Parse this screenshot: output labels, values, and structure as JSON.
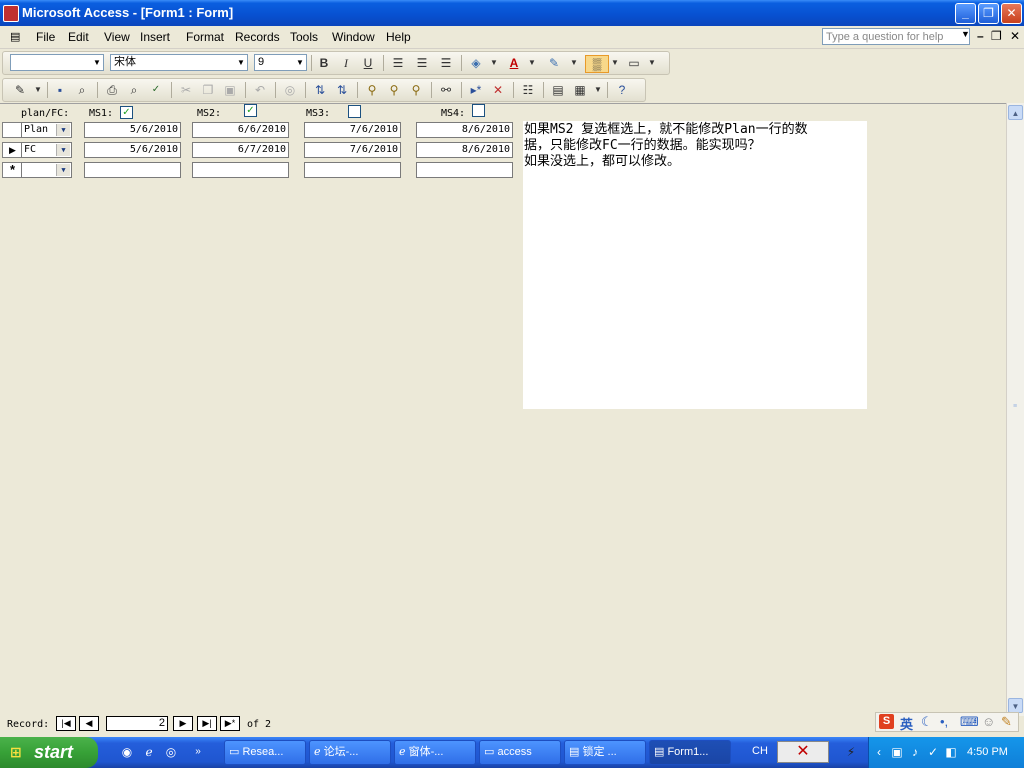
{
  "window": {
    "title": "Microsoft Access - [Form1 : Form]"
  },
  "menu": {
    "items": [
      "File",
      "Edit",
      "View",
      "Insert",
      "Format",
      "Records",
      "Tools",
      "Window",
      "Help"
    ],
    "help_placeholder": "Type a question for help"
  },
  "formatting_toolbar": {
    "object_value": "",
    "font_value": "宋体",
    "size_value": "9"
  },
  "form": {
    "header_labels": {
      "plan_fc": "plan/FC:",
      "ms1": "MS1:",
      "ms2": "MS2:",
      "ms3": "MS3:",
      "ms4": "MS4:"
    },
    "header_checks": {
      "ms1": true,
      "ms2": true,
      "ms3": false,
      "ms4": false
    },
    "rows": [
      {
        "selector": "",
        "type": "Plan",
        "ms1": "5/6/2010",
        "ms2": "6/6/2010",
        "ms3": "7/6/2010",
        "ms4": "8/6/2010"
      },
      {
        "selector": "▶",
        "type": "FC",
        "ms1": "5/6/2010",
        "ms2": "6/7/2010",
        "ms3": "7/6/2010",
        "ms4": "8/6/2010"
      },
      {
        "selector": "*",
        "type": "",
        "ms1": "",
        "ms2": "",
        "ms3": "",
        "ms4": ""
      }
    ],
    "note_lines": [
      "如果MS2 复选框选上，就不能修改Plan一行的数",
      "据，只能修改FC一行的数据。能实现吗？",
      "如果没选上，都可以修改。"
    ]
  },
  "record_nav": {
    "label": "Record:",
    "current": "2",
    "of_text": "of 2"
  },
  "taskbar": {
    "start_label": "start",
    "tasks": [
      "Resea...",
      "论坛-...",
      "窗体-...",
      "access",
      "锁定 ...",
      "Form1..."
    ],
    "lang": "CH",
    "time": "4:50 PM"
  }
}
